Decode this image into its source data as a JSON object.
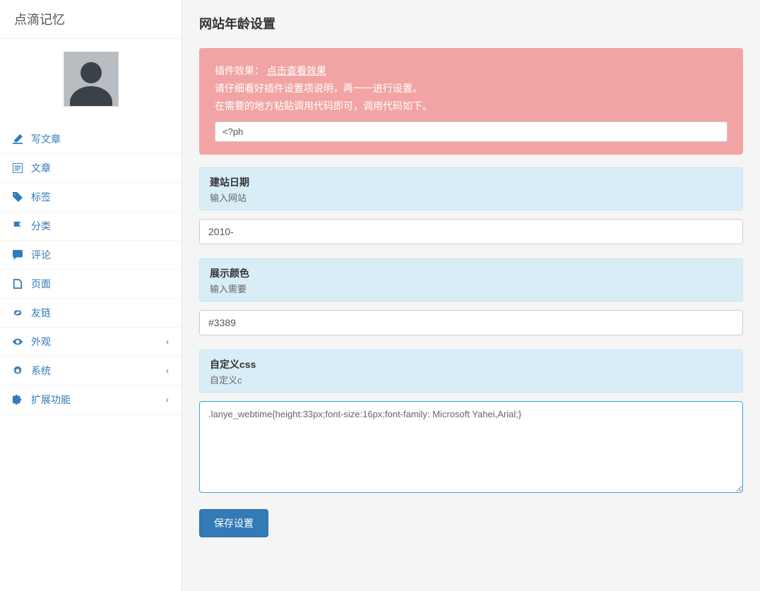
{
  "brand": "点滴记忆",
  "sidebar": {
    "items": [
      {
        "label": "写文章",
        "icon": "edit"
      },
      {
        "label": "文章",
        "icon": "list"
      },
      {
        "label": "标签",
        "icon": "tags"
      },
      {
        "label": "分类",
        "icon": "flag"
      },
      {
        "label": "评论",
        "icon": "comments"
      },
      {
        "label": "页面",
        "icon": "file"
      },
      {
        "label": "友链",
        "icon": "link"
      },
      {
        "label": "外观",
        "icon": "eye",
        "expandable": true
      },
      {
        "label": "系统",
        "icon": "gear",
        "expandable": true
      },
      {
        "label": "扩展功能",
        "icon": "puzzle",
        "expandable": true
      }
    ]
  },
  "page": {
    "title": "网站年龄设置"
  },
  "alert": {
    "line1_prefix": "插件效果：",
    "line1_link": "点击查看效果",
    "line2": "请仔细看好插件设置项说明，再一一进行设置。",
    "line3": "在需要的地方粘贴调用代码即可，调用代码如下。",
    "code_value": "<?ph"
  },
  "section_date": {
    "title": "建站日期",
    "desc": "输入网站",
    "value": "2010-"
  },
  "section_color": {
    "title": "展示颜色",
    "desc": "输入需要",
    "value": "#3389"
  },
  "section_css": {
    "title": "自定义css",
    "desc": "自定义c",
    "value": ".lanye_webtime{height:33px;font-size:16px;font-family: Microsoft Yahei,Arial;}"
  },
  "buttons": {
    "save": "保存设置"
  }
}
